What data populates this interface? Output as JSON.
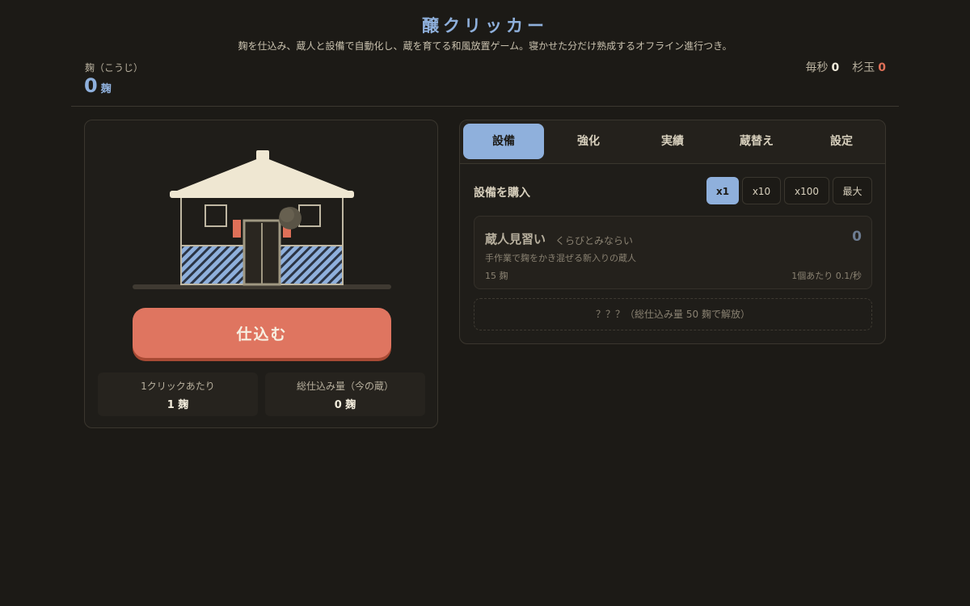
{
  "header": {
    "title": "醸クリッカー",
    "subtitle": "麹を仕込み、蔵人と設備で自動化し、蔵を育てる和風放置ゲーム。寝かせた分だけ熟成するオフライン進行つき。",
    "koji_label": "麹（こうじ）",
    "koji_value": "0",
    "koji_unit": "麹",
    "per_sec_label": "毎秒",
    "per_sec_value": "0",
    "sugidama_label": "杉玉",
    "sugidama_value": "0"
  },
  "left": {
    "brew_button": "仕込む",
    "stats": [
      {
        "label": "1クリックあたり",
        "value": "1 麹"
      },
      {
        "label": "総仕込み量（今の蔵）",
        "value": "0 麹"
      }
    ]
  },
  "right": {
    "tabs": [
      {
        "label": "設備",
        "active": true
      },
      {
        "label": "強化",
        "active": false
      },
      {
        "label": "実績",
        "active": false
      },
      {
        "label": "蔵替え",
        "active": false
      },
      {
        "label": "設定",
        "active": false
      }
    ],
    "section_label": "設備を購入",
    "multipliers": [
      {
        "label": "x1",
        "active": true
      },
      {
        "label": "x10",
        "active": false
      },
      {
        "label": "x100",
        "active": false
      },
      {
        "label": "最大",
        "active": false
      }
    ],
    "item": {
      "name": "蔵人見習い",
      "reading": "くらびとみならい",
      "count": "0",
      "description": "手作業で麹をかき混ぜる新入りの蔵人",
      "cost": "15 麹",
      "rate": "1個あたり 0.1/秒"
    },
    "locked_text": "？？？（総仕込み量 50 麹で解放）"
  },
  "colors": {
    "background": "#1c1a16",
    "accent_blue": "#8fb0dc",
    "button_red": "#df7560",
    "sugidama_red": "#df7058",
    "house_cream": "#efe7d2",
    "house_stripe": "#8fb0dc"
  }
}
